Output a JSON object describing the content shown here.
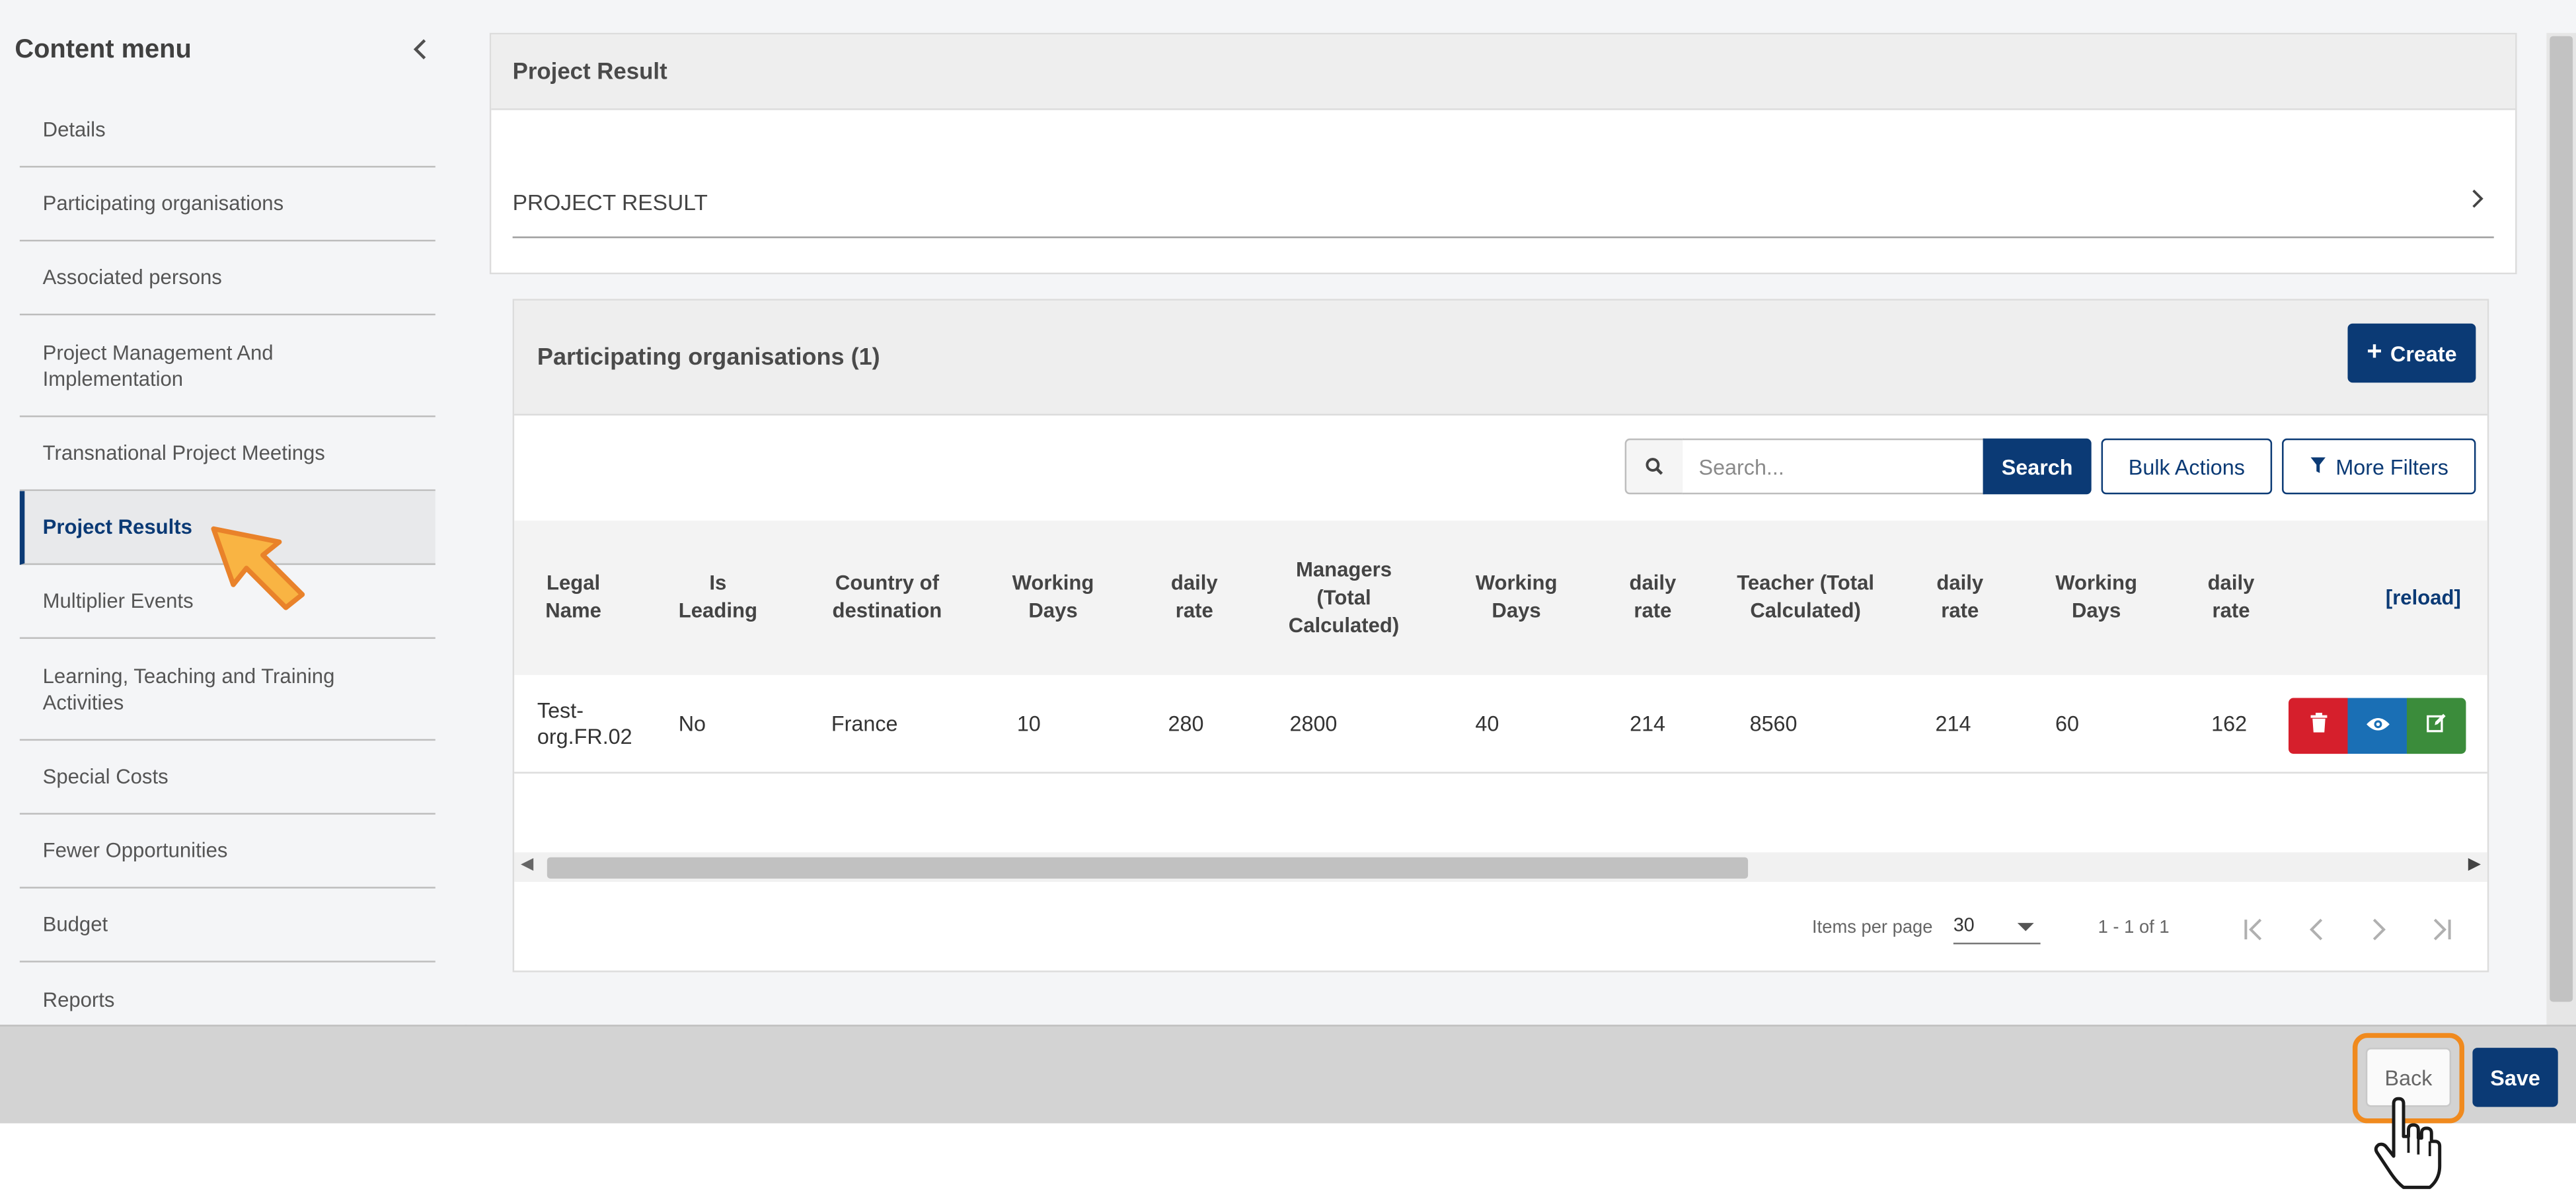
{
  "sidebar": {
    "title": "Content menu",
    "items": [
      {
        "label": "Details"
      },
      {
        "label": "Participating organisations"
      },
      {
        "label": "Associated persons"
      },
      {
        "label": "Project Management And Implementation"
      },
      {
        "label": "Transnational Project Meetings"
      },
      {
        "label": "Project Results",
        "active": true
      },
      {
        "label": "Multiplier Events"
      },
      {
        "label": "Learning, Teaching and Training Activities"
      },
      {
        "label": "Special Costs"
      },
      {
        "label": "Fewer Opportunities"
      },
      {
        "label": "Budget"
      },
      {
        "label": "Reports"
      }
    ]
  },
  "project_result": {
    "header": "Project Result",
    "accordion_label": "PROJECT RESULT"
  },
  "participating": {
    "title": "Participating organisations (1)",
    "create_label": "Create",
    "search_placeholder": "Search...",
    "search_label": "Search",
    "bulk_label": "Bulk Actions",
    "filters_label": "More Filters",
    "columns": [
      "Legal Name",
      "Is Leading",
      "Country of destination",
      "Working Days",
      "daily rate",
      "Managers (Total Calculated)",
      "Working Days",
      "daily rate",
      "Teacher (Total Calculated)",
      "daily rate",
      "Working Days",
      "daily rate"
    ],
    "reload_label": "[reload]",
    "rows": [
      {
        "cells": [
          "Test-org.FR.02",
          "No",
          "France",
          "10",
          "280",
          "2800",
          "40",
          "214",
          "8560",
          "214",
          "60",
          "162"
        ]
      }
    ],
    "pager": {
      "items_per_page_label": "Items per page",
      "items_per_page": "30",
      "range": "1 - 1 of 1"
    }
  },
  "footer": {
    "back_label": "Back",
    "save_label": "Save"
  },
  "colors": {
    "primary": "#0b3a75",
    "danger": "#d61f2c",
    "info": "#1a6fb5",
    "success": "#3b8c3b",
    "highlight": "#f08a1e"
  },
  "icons": {
    "collapse": "chevron-left-icon",
    "accordion": "chevron-right-icon",
    "create": "plus-icon",
    "search": "search-icon",
    "filter": "filter-icon",
    "delete": "trash-icon",
    "view": "eye-icon",
    "edit": "edit-icon"
  }
}
